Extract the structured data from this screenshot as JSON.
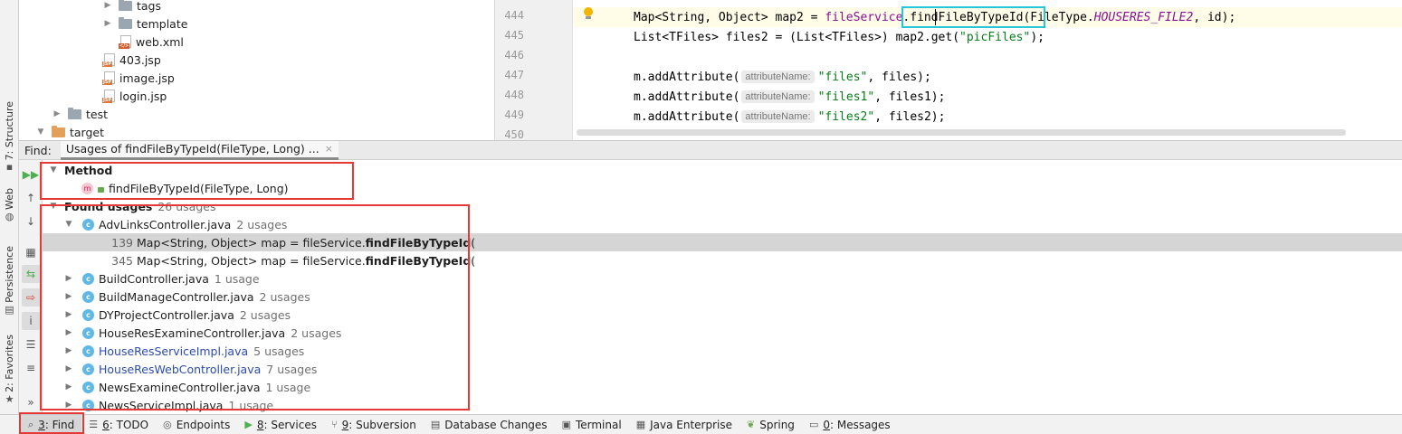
{
  "left_strip": {
    "tabs": [
      {
        "label": "7: Structure",
        "icon": "structure-icon"
      },
      {
        "label": "Web",
        "icon": "globe-icon"
      },
      {
        "label": "Persistence",
        "icon": "persistence-icon"
      },
      {
        "label": "2: Favorites",
        "icon": "star-icon"
      }
    ]
  },
  "project_tree": {
    "items": [
      {
        "label": "tags",
        "type": "folder"
      },
      {
        "label": "template",
        "type": "folder"
      },
      {
        "label": "web.xml",
        "type": "xml"
      },
      {
        "label": "403.jsp",
        "type": "jsp"
      },
      {
        "label": "image.jsp",
        "type": "jsp"
      },
      {
        "label": "login.jsp",
        "type": "jsp"
      },
      {
        "label": "test",
        "type": "folder"
      },
      {
        "label": "target",
        "type": "folder-orange"
      }
    ]
  },
  "editor": {
    "line_numbers": [
      "444",
      "445",
      "446",
      "447",
      "448",
      "449",
      "450"
    ],
    "line444": {
      "a": "Map<String, Object> map2 = ",
      "field": "fileService",
      "b": ".findFileByTypeId(FileType.",
      "static": "HOUSERES_FILE2",
      "c": ", id);"
    },
    "line445": {
      "a": "List<TFiles> files2 = (List<TFiles>) map2.get(",
      "str": "\"picFiles\"",
      "c": ");"
    },
    "line447": {
      "a": "m.addAttribute(",
      "hint": "attributeName:",
      "str": "\"files\"",
      "c": ", files);"
    },
    "line448": {
      "a": "m.addAttribute(",
      "hint": "attributeName:",
      "str": "\"files1\"",
      "c": ", files1);"
    },
    "line449": {
      "a": "m.addAttribute(",
      "hint": "attributeName:",
      "str": "\"files2\"",
      "c": ", files2);"
    }
  },
  "find": {
    "label": "Find:",
    "tab_title": "Usages of findFileByTypeId(FileType, Long) ...",
    "close_glyph": "×",
    "method_header": "Method",
    "method_signature": "findFileByTypeId(FileType, Long)",
    "method_icon_letter": "m",
    "found_header": "Found usages",
    "found_count": "26 usages",
    "class_icon_letter": "c",
    "groups": [
      {
        "name": "AdvLinksController.java",
        "count": "2 usages",
        "expanded": true,
        "blue": false
      },
      {
        "name": "BuildController.java",
        "count": "1 usage",
        "expanded": false,
        "blue": false
      },
      {
        "name": "BuildManageController.java",
        "count": "2 usages",
        "expanded": false,
        "blue": false
      },
      {
        "name": "DYProjectController.java",
        "count": "2 usages",
        "expanded": false,
        "blue": false
      },
      {
        "name": "HouseResExamineController.java",
        "count": "2 usages",
        "expanded": false,
        "blue": false
      },
      {
        "name": "HouseResServiceImpl.java",
        "count": "5 usages",
        "expanded": false,
        "blue": true
      },
      {
        "name": "HouseResWebController.java",
        "count": "7 usages",
        "expanded": false,
        "blue": true
      },
      {
        "name": "NewsExamineController.java",
        "count": "1 usage",
        "expanded": false,
        "blue": false
      },
      {
        "name": "NewsServiceImpl.java",
        "count": "1 usage",
        "expanded": false,
        "blue": false
      }
    ],
    "usages": [
      {
        "line": "139",
        "prefix": "Map<String, Object> map = fileService.",
        "match": "findFileByTypeId",
        "suffix": "(",
        "selected": true
      },
      {
        "line": "345",
        "prefix": "Map<String, Object> map = fileService.",
        "match": "findFileByTypeId",
        "suffix": "(",
        "selected": false
      }
    ]
  },
  "bottom_bar": {
    "items": [
      {
        "mnemonic": "3",
        "label": ": Find",
        "icon": "search-icon",
        "active": true
      },
      {
        "mnemonic": "6",
        "label": ": TODO",
        "icon": "list-icon",
        "active": false
      },
      {
        "mnemonic": "",
        "label": "Endpoints",
        "icon": "endpoints-icon",
        "active": false
      },
      {
        "mnemonic": "8",
        "label": ": Services",
        "icon": "services-icon",
        "active": false
      },
      {
        "mnemonic": "9",
        "label": ": Subversion",
        "icon": "branch-icon",
        "active": false
      },
      {
        "mnemonic": "",
        "label": "Database Changes",
        "icon": "database-icon",
        "active": false
      },
      {
        "mnemonic": "",
        "label": "Terminal",
        "icon": "terminal-icon",
        "active": false
      },
      {
        "mnemonic": "",
        "label": "Java Enterprise",
        "icon": "java-enterprise-icon",
        "active": false
      },
      {
        "mnemonic": "",
        "label": "Spring",
        "icon": "spring-icon",
        "active": false
      },
      {
        "mnemonic": "0",
        "label": ": Messages",
        "icon": "messages-icon",
        "active": false
      }
    ]
  },
  "colors": {
    "highlight_box": "#e53935",
    "caret_box": "#26c6da",
    "selection": "#d5d5d5"
  }
}
